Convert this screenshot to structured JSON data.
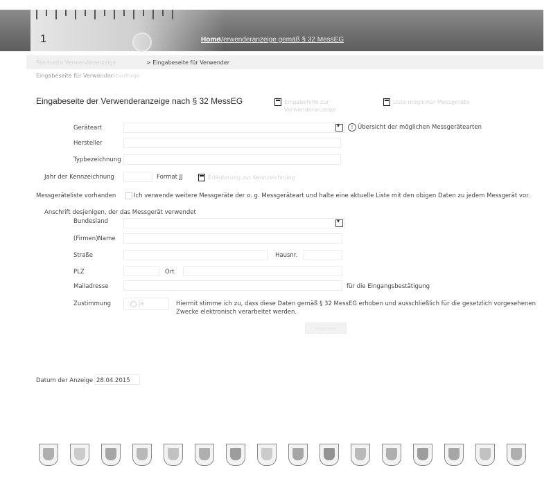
{
  "header": {
    "ruler_label": "1",
    "home_link": "Home",
    "title_link": "Verwenderanzeige gemäß § 32 MessEG"
  },
  "breadcrumb": {
    "prev": "Startseite Verwenderanzeige",
    "current": "> Eingabeseite für Verwender"
  },
  "subnav": {
    "active": "Eingabeseite für Verwender",
    "other": "Kontaktanfrage"
  },
  "page": {
    "title": "Eingabeseite der Verwenderanzeige nach § 32 MessEG",
    "link1": "Eingabehilfe zur Verwenderanzeige",
    "link2": "Liste möglicher Messgeräte"
  },
  "form": {
    "geraeteart_label": "Geräteart",
    "geraeteart_info": "Übersicht der möglichen Messgerätearten",
    "hersteller_label": "Hersteller",
    "typ_label": "Typbezeichnung",
    "jahr_label": "Jahr der Kennzeichnung",
    "jahr_format": "Format JJ",
    "jahr_help": "Erläuterung zur Kennzeichnung",
    "liste_label": "Messgeräteliste vorhanden",
    "liste_text": "Ich verwende weitere Messgeräte der o. g. Messgeräteart und halte eine aktuelle Liste mit den obigen Daten zu jedem Messgerät vor.",
    "anschrift_heading": "Anschrift desjenigen, der das Messgerät verwendet",
    "bundesland_label": "Bundesland",
    "firma_label": "(Firmen)Name",
    "strasse_label": "Straße",
    "hausnr_label": "Hausnr.",
    "plz_label": "PLZ",
    "ort_label": "Ort",
    "mail_label": "Mailadresse",
    "mail_hint": "für die Eingangsbestätigung",
    "zustimmung_label": "Zustimmung",
    "zustimmung_option": "ja",
    "zustimmung_text_1": "Hiermit stimme ich zu, dass diese Daten gemäß § 32 MessEG erhoben und ausschließlich für die gesetzlich vorgesehenen",
    "zustimmung_text_2": "Zwecke elektronisch verarbeitet werden.",
    "submit_label": "Absenden"
  },
  "datum": {
    "label": "Datum der Anzeige",
    "value": "28.04.2015"
  },
  "icons": {
    "document": "document-icon",
    "info": "info-icon",
    "dropdown": "chevron-down-icon",
    "coat_of_arms": "coat-of-arms-icon"
  }
}
